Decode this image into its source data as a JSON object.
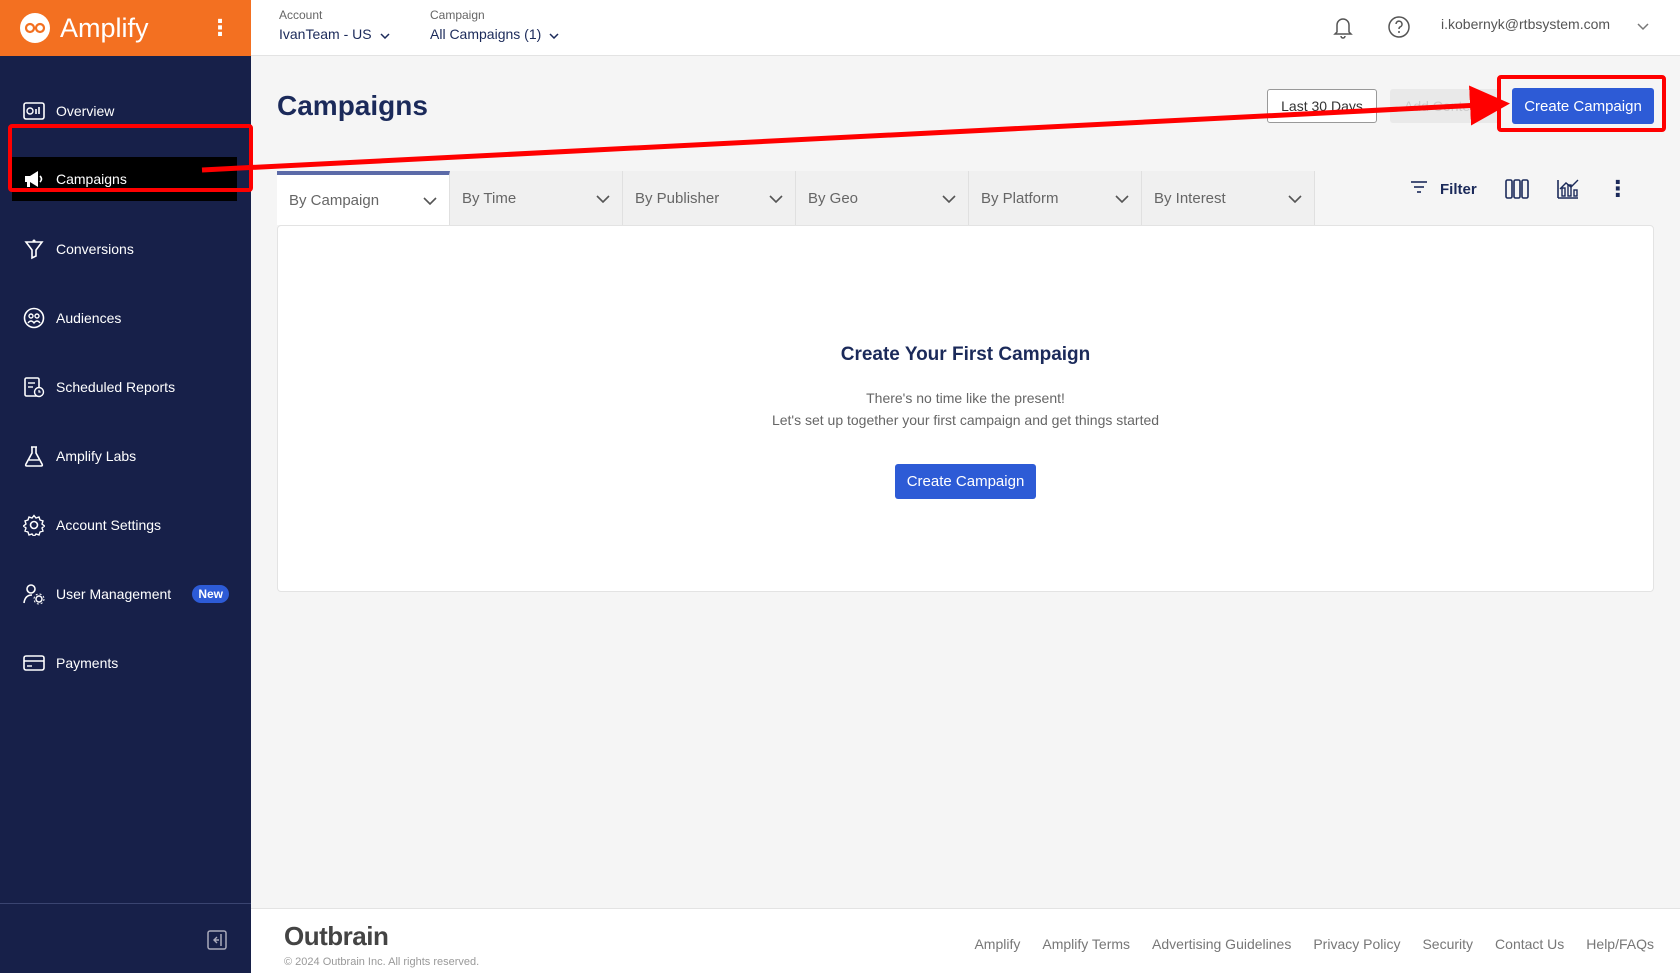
{
  "brand": {
    "name": "Amplify"
  },
  "sidebar": {
    "items": [
      {
        "label": "Overview",
        "icon": "overview-icon"
      },
      {
        "label": "Campaigns",
        "icon": "megaphone-icon",
        "active": true
      },
      {
        "label": "Conversions",
        "icon": "conversions-icon"
      },
      {
        "label": "Audiences",
        "icon": "audiences-icon"
      },
      {
        "label": "Scheduled Reports",
        "icon": "scheduled-reports-icon"
      },
      {
        "label": "Amplify Labs",
        "icon": "flask-icon"
      },
      {
        "label": "Account Settings",
        "icon": "gear-icon"
      },
      {
        "label": "User Management",
        "icon": "user-gear-icon",
        "badge": "New"
      },
      {
        "label": "Payments",
        "icon": "credit-card-icon"
      }
    ]
  },
  "topbar": {
    "account_label": "Account",
    "account_value": "IvanTeam - US",
    "campaign_label": "Campaign",
    "campaign_value": "All Campaigns (1)",
    "user_email": "i.kobernyk@rtbsystem.com"
  },
  "main": {
    "title": "Campaigns",
    "date_range": "Last 30 Days",
    "add_content": "Add Content",
    "create_campaign": "Create Campaign",
    "tabs": [
      {
        "label": "By Campaign",
        "active": true
      },
      {
        "label": "By Time"
      },
      {
        "label": "By Publisher"
      },
      {
        "label": "By Geo"
      },
      {
        "label": "By Platform"
      },
      {
        "label": "By Interest"
      }
    ],
    "filter_label": "Filter",
    "empty": {
      "title": "Create Your First Campaign",
      "line1": "There's no time like the present!",
      "line2": "Let's set up together your first campaign and get things started",
      "button": "Create Campaign"
    }
  },
  "footer": {
    "logo": "Outbrain",
    "copyright": "© 2024 Outbrain Inc. All rights reserved.",
    "links": [
      "Amplify",
      "Amplify Terms",
      "Advertising Guidelines",
      "Privacy Policy",
      "Security",
      "Contact Us",
      "Help/FAQs"
    ]
  },
  "colors": {
    "sidebar_bg": "#172049",
    "brand_orange": "#f37021",
    "primary": "#2d5bd6",
    "annotation": "#ff0000"
  }
}
